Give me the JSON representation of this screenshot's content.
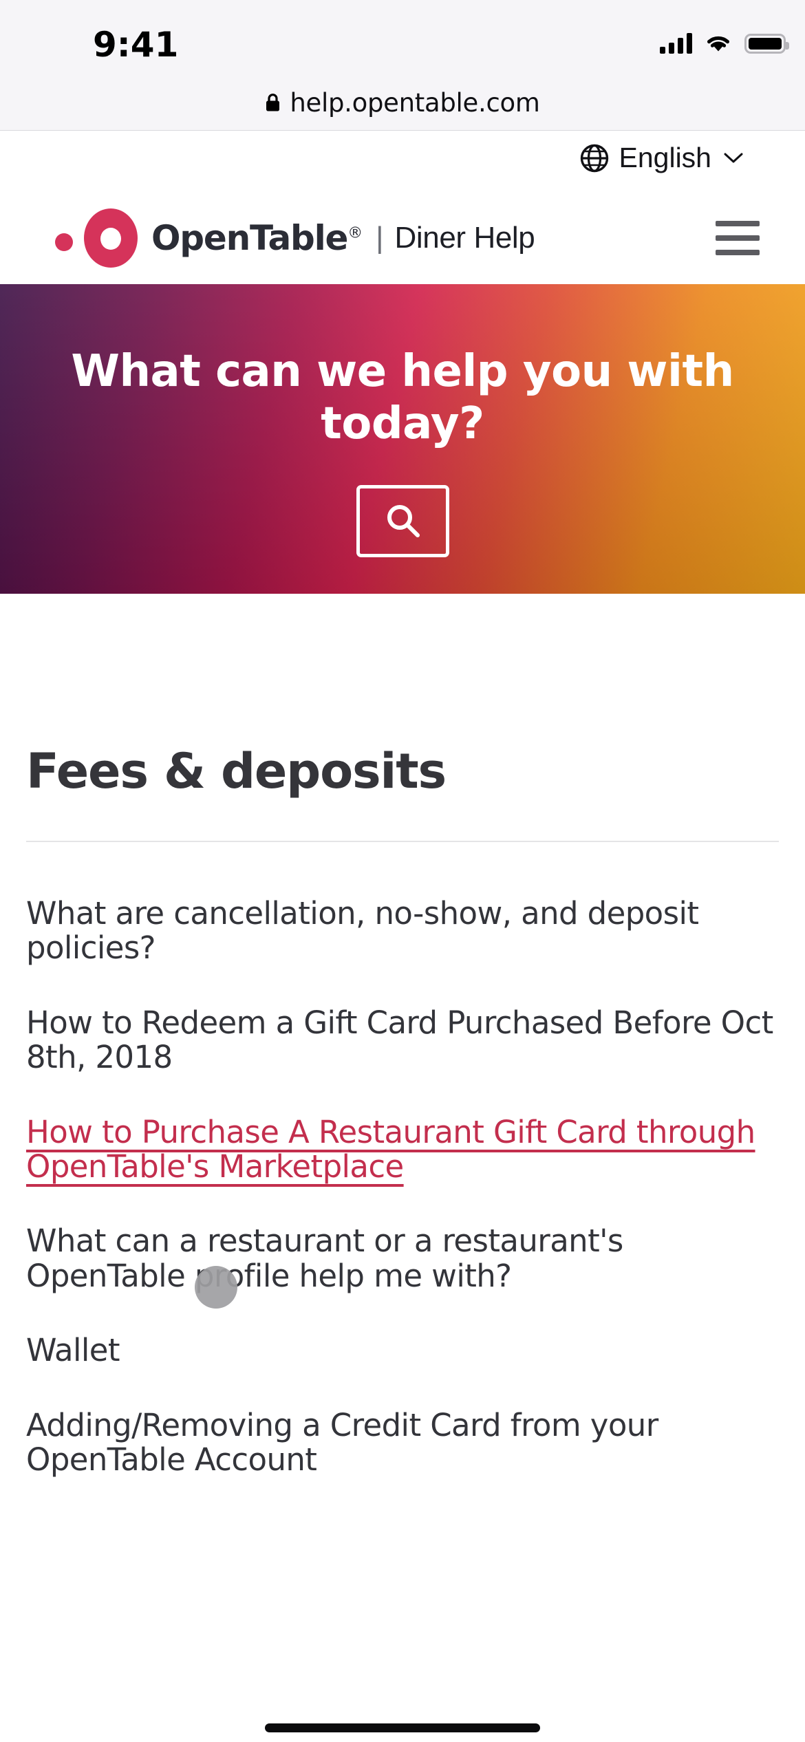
{
  "status_bar": {
    "time": "9:41",
    "cellular_icon": "signal-bars-icon",
    "wifi_icon": "wifi-icon",
    "battery_icon": "battery-full-icon"
  },
  "browser": {
    "lock_icon": "lock-icon",
    "url": "help.opentable.com"
  },
  "language_bar": {
    "globe_icon": "globe-icon",
    "label": "English",
    "chevron_icon": "chevron-down-icon"
  },
  "header": {
    "brand_name": "OpenTable",
    "registered_mark": "®",
    "separator": "|",
    "sub_brand": "Diner Help",
    "menu_icon": "hamburger-menu-icon"
  },
  "hero": {
    "title": "What can we help you with today?",
    "search_icon": "search-icon",
    "gradient_from": "#3c1045",
    "gradient_mid": "#d3204b",
    "gradient_to": "#f5a91a"
  },
  "main": {
    "page_title": "Fees & deposits",
    "articles": [
      {
        "text": "What are cancellation, no-show, and deposit policies?",
        "highlighted": false
      },
      {
        "text": "How to Redeem a Gift Card Purchased Before Oct 8th, 2018",
        "highlighted": false
      },
      {
        "text": "How to Purchase A Restaurant Gift Card through OpenTable's Marketplace",
        "highlighted": true
      },
      {
        "text": "What can a restaurant or a restaurant's OpenTable profile help me with?",
        "highlighted": false
      },
      {
        "text": "Wallet",
        "highlighted": false
      },
      {
        "text": "Adding/Removing a Credit Card from your OpenTable Account",
        "highlighted": false
      }
    ]
  },
  "colors": {
    "brand_red": "#d5335a",
    "link_red": "#c32e4d",
    "text_dark": "#33343a",
    "chrome_bg": "#f6f5f8"
  }
}
